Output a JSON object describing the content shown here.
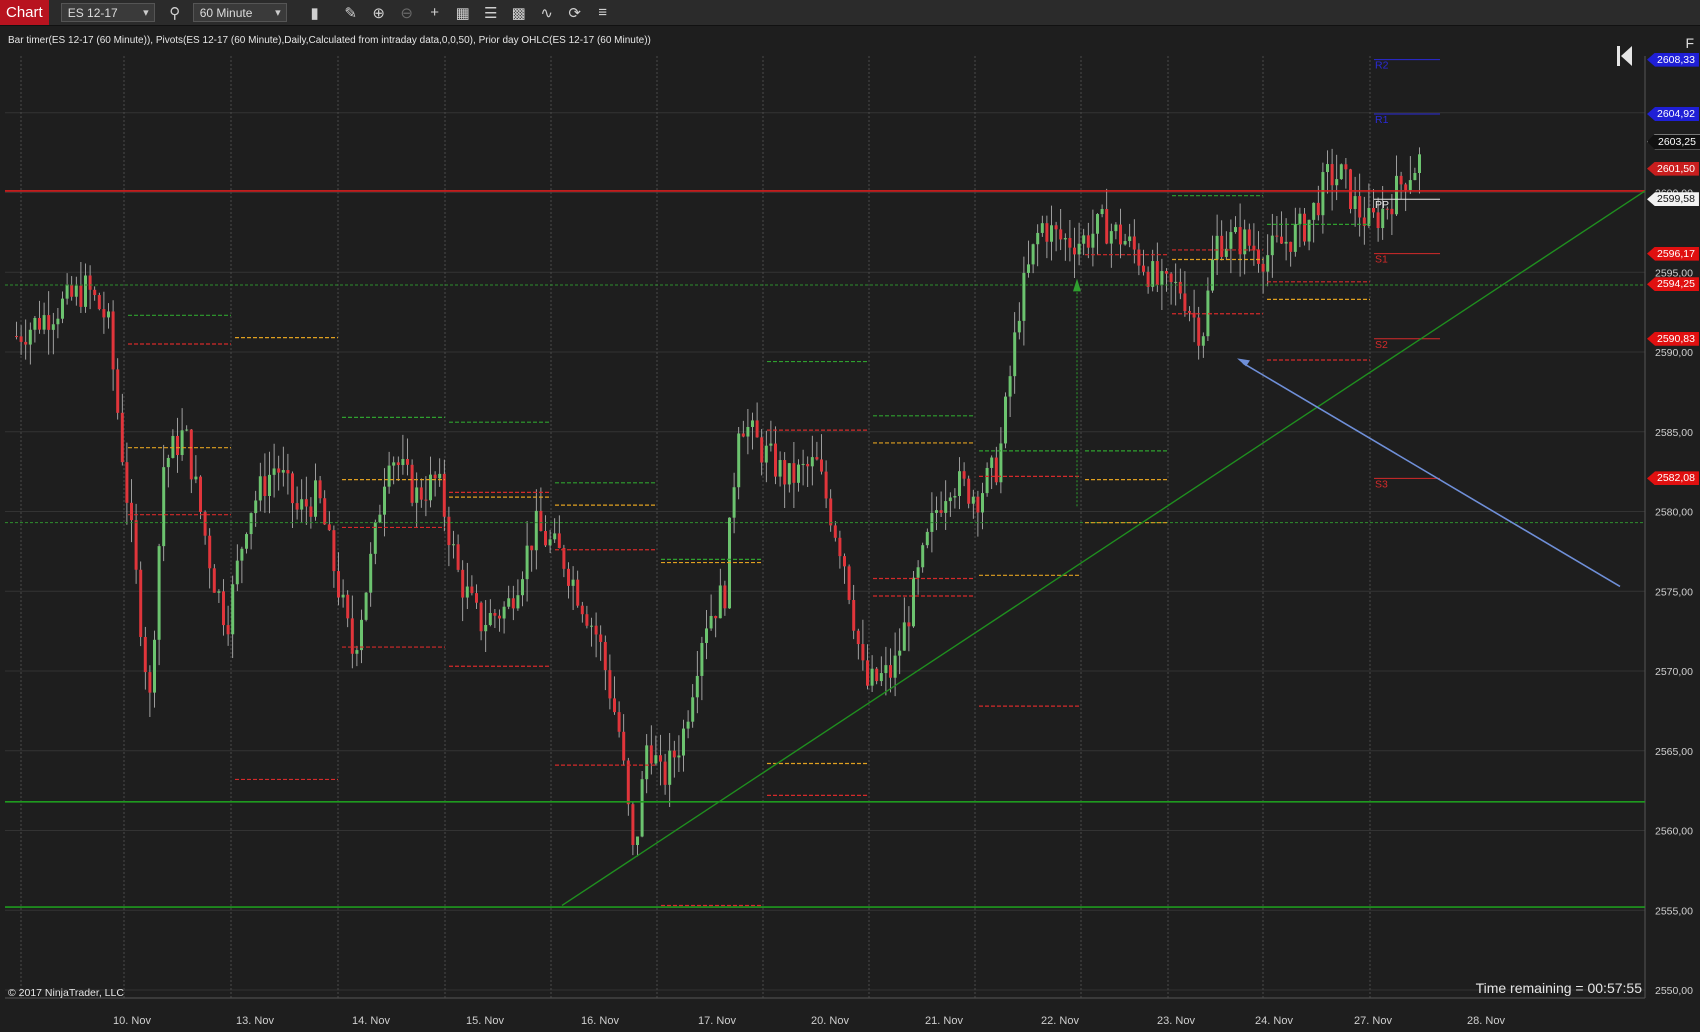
{
  "toolbar": {
    "tab_label": "Chart",
    "instrument": "ES 12-17",
    "interval": "60 Minute",
    "icons": [
      "search-icon",
      "bars-type-icon",
      "pencil-draw-icon",
      "zoom-in-icon",
      "zoom-out-icon",
      "crosshair-icon",
      "data-box-icon",
      "properties-icon",
      "templates-icon",
      "strategies-icon",
      "reload-icon",
      "list-icon"
    ]
  },
  "chart": {
    "indicator_title": "Bar timer(ES 12-17 (60 Minute)), Pivots(ES 12-17 (60 Minute),Daily,Calculated from intraday data,0,0,50), Prior day OHLC(ES 12-17 (60 Minute))",
    "copyright": "© 2017 NinjaTrader, LLC",
    "time_remaining": "Time remaining = 00:57:55",
    "corner_label": "F",
    "colors": {
      "background": "#1e1e1e",
      "up": "#6cc36f",
      "down": "#e0353b",
      "grid": "#3a3a3a",
      "red_line": "#d71f1f",
      "green_line": "#1f9a1f",
      "trend": "#1f8f1f",
      "arrow": "#6f8fd8"
    }
  },
  "chart_data": {
    "type": "candlestick",
    "x_labels": [
      "10. Nov",
      "13. Nov",
      "14. Nov",
      "15. Nov",
      "16. Nov",
      "17. Nov",
      "20. Nov",
      "21. Nov",
      "22. Nov",
      "23. Nov",
      "24. Nov",
      "27. Nov",
      "28. Nov"
    ],
    "y_ticks": [
      2550,
      2555,
      2560,
      2565,
      2570,
      2575,
      2580,
      2585,
      2590,
      2595,
      2600,
      2605
    ],
    "y_tick_labels": [
      "2550,00",
      "2555,00",
      "2560,00",
      "2565,00",
      "2570,00",
      "2575,00",
      "2580,00",
      "2585,00",
      "2590,00",
      "2595,00",
      "2600,00",
      "2605,00"
    ],
    "ylim": [
      2549,
      2610.5
    ],
    "price_path": [
      [
        0,
        2591
      ],
      [
        1,
        2594
      ],
      [
        1.3,
        2592
      ],
      [
        1.6,
        2580
      ],
      [
        1.9,
        2568
      ],
      [
        2.1,
        2583
      ],
      [
        2.4,
        2585
      ],
      [
        2.8,
        2576
      ],
      [
        3.0,
        2573
      ],
      [
        3.3,
        2580
      ],
      [
        3.7,
        2583
      ],
      [
        4.0,
        2580
      ],
      [
        4.3,
        2581
      ],
      [
        4.8,
        2571
      ],
      [
        5.1,
        2578
      ],
      [
        5.3,
        2584
      ],
      [
        5.7,
        2581
      ],
      [
        6.0,
        2582
      ],
      [
        6.3,
        2576
      ],
      [
        6.6,
        2573
      ],
      [
        7.0,
        2574
      ],
      [
        7.4,
        2579
      ],
      [
        7.8,
        2577
      ],
      [
        8.3,
        2572
      ],
      [
        8.6,
        2566
      ],
      [
        8.8,
        2558
      ],
      [
        9.0,
        2566
      ],
      [
        9.2,
        2563
      ],
      [
        9.5,
        2566
      ],
      [
        9.8,
        2573
      ],
      [
        10.1,
        2575
      ],
      [
        10.3,
        2586
      ],
      [
        10.6,
        2584
      ],
      [
        11.0,
        2582
      ],
      [
        11.4,
        2583
      ],
      [
        11.8,
        2577
      ],
      [
        12.1,
        2569
      ],
      [
        12.5,
        2570
      ],
      [
        12.8,
        2575
      ],
      [
        13.1,
        2580
      ],
      [
        13.3,
        2582
      ],
      [
        13.7,
        2581
      ],
      [
        14.0,
        2583
      ],
      [
        14.3,
        2593
      ],
      [
        14.6,
        2598
      ],
      [
        14.9,
        2597
      ],
      [
        15.2,
        2597
      ],
      [
        15.5,
        2598
      ],
      [
        15.8,
        2597
      ],
      [
        16.0,
        2596
      ],
      [
        16.3,
        2594
      ],
      [
        16.6,
        2594
      ],
      [
        16.9,
        2591
      ],
      [
        17.1,
        2597
      ],
      [
        17.5,
        2597
      ],
      [
        17.8,
        2596
      ],
      [
        18.1,
        2597
      ],
      [
        18.4,
        2598
      ],
      [
        18.7,
        2601
      ],
      [
        18.9,
        2601
      ],
      [
        19.1,
        2599
      ],
      [
        19.3,
        2598
      ],
      [
        19.5,
        2599
      ],
      [
        19.8,
        2601
      ],
      [
        20.0,
        2602
      ]
    ],
    "horizontal_levels": [
      {
        "price": 2600.1,
        "color": "red",
        "label": ""
      },
      {
        "price": 2561.8,
        "color": "green",
        "label": ""
      },
      {
        "price": 2555.2,
        "color": "green",
        "label": ""
      }
    ],
    "pivot_labels": [
      "R2",
      "R1",
      "PP",
      "S1",
      "S2",
      "S3"
    ],
    "trendline": [
      [
        2556,
        "16. Nov"
      ],
      [
        2600,
        "28. Nov"
      ]
    ],
    "price_markers": [
      {
        "label": "2608,33",
        "bg": "#1f1fd6",
        "price": 2608.33
      },
      {
        "label": "2604,92",
        "bg": "#1f1fd6",
        "price": 2604.92
      },
      {
        "label": "2603,25",
        "bg": "#111111",
        "price": 2603.25
      },
      {
        "label": "2601,50",
        "bg": "#c81e1e",
        "price": 2601.5
      },
      {
        "label": "2599,58",
        "bg": "#f2f2f2",
        "fg": "#111",
        "price": 2599.58
      },
      {
        "label": "2596,17",
        "bg": "#e01010",
        "price": 2596.17
      },
      {
        "label": "2594,25",
        "bg": "#e01010",
        "price": 2594.25
      },
      {
        "label": "2590,83",
        "bg": "#e01010",
        "price": 2590.83
      },
      {
        "label": "2582,08",
        "bg": "#e01010",
        "price": 2582.08
      }
    ]
  }
}
